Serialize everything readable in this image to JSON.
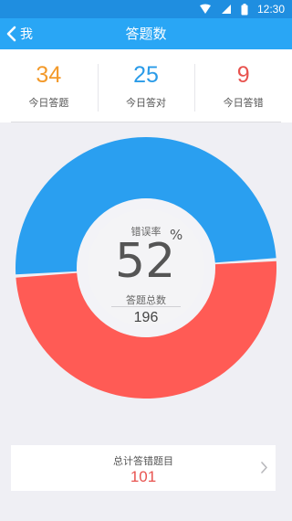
{
  "status_bar": {
    "time": "12:30",
    "icons": [
      "wifi-icon",
      "signal-icon",
      "battery-icon"
    ]
  },
  "nav": {
    "back_label": "我",
    "title": "答题数"
  },
  "stats": [
    {
      "value": "34",
      "label": "今日答题",
      "color": "#f39a2b"
    },
    {
      "value": "25",
      "label": "今日答对",
      "color": "#2a9be8"
    },
    {
      "value": "9",
      "label": "今日答错",
      "color": "#e8534f"
    }
  ],
  "gauge": {
    "rate_label": "错误率",
    "rate_value": "52",
    "rate_unit": "%",
    "total_label": "答题总数",
    "total_value": "196",
    "error_fraction": 0.52,
    "colors": {
      "correct": "#2a9ff0",
      "error": "#ff5b55"
    }
  },
  "summary": {
    "label": "总计答错题目",
    "value": "101"
  }
}
